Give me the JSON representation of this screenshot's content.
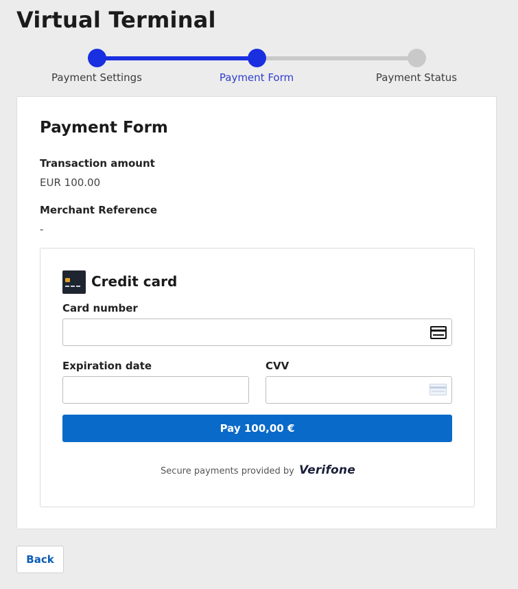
{
  "header": {
    "title": "Virtual Terminal"
  },
  "stepper": {
    "steps": [
      {
        "label": "Payment Settings",
        "state": "completed"
      },
      {
        "label": "Payment Form",
        "state": "current"
      },
      {
        "label": "Payment Status",
        "state": "pending"
      }
    ],
    "colors": {
      "active": "#1a2fe0",
      "inactive": "#c9c9c9",
      "current_label": "#2e3fce"
    }
  },
  "form": {
    "title": "Payment Form",
    "transaction_amount_label": "Transaction amount",
    "transaction_amount_value": "EUR 100.00",
    "merchant_reference_label": "Merchant Reference",
    "merchant_reference_value": "-"
  },
  "payment": {
    "method_title": "Credit card",
    "method_icon": "credit-card-icon",
    "card_number_label": "Card number",
    "card_number_value": "",
    "card_number_icon": "card-icon",
    "expiration_label": "Expiration date",
    "expiration_value": "",
    "cvv_label": "CVV",
    "cvv_value": "",
    "cvv_icon": "cvv-card-icon",
    "pay_button_label": "Pay 100,00 €",
    "pay_button_color": "#0a6ac9",
    "secure_text": "Secure payments provided by",
    "provider_name": "Verifone"
  },
  "footer": {
    "back_button_label": "Back"
  }
}
